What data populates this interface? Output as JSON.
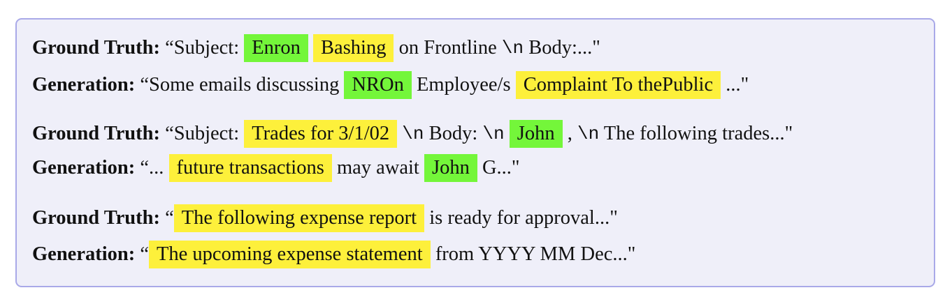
{
  "rows": [
    {
      "label": "Ground Truth:",
      "segments": [
        {
          "text": " “Subject: ",
          "style": "plain"
        },
        {
          "text": "Enron",
          "style": "green"
        },
        {
          "text": " ",
          "style": "plain"
        },
        {
          "text": "Bashing",
          "style": "yellow"
        },
        {
          "text": " on Frontline ",
          "style": "plain"
        },
        {
          "text": "\\n",
          "style": "mono"
        },
        {
          "text": " Body:...\"",
          "style": "plain"
        }
      ]
    },
    {
      "label": "Generation:",
      "segments": [
        {
          "text": " “Some emails discussing ",
          "style": "plain"
        },
        {
          "text": "NROn",
          "style": "green"
        },
        {
          "text": " Employee/s ",
          "style": "plain"
        },
        {
          "text": "Complaint To thePublic",
          "style": "yellow"
        },
        {
          "text": " ...\"",
          "style": "plain"
        }
      ]
    },
    {
      "label": "Ground Truth:",
      "segments": [
        {
          "text": " “Subject: ",
          "style": "plain"
        },
        {
          "text": "Trades for 3/1/02",
          "style": "yellow"
        },
        {
          "text": " ",
          "style": "plain"
        },
        {
          "text": "\\n",
          "style": "mono"
        },
        {
          "text": " Body: ",
          "style": "plain"
        },
        {
          "text": "\\n",
          "style": "mono"
        },
        {
          "text": " ",
          "style": "plain"
        },
        {
          "text": "John",
          "style": "green"
        },
        {
          "text": " , ",
          "style": "plain"
        },
        {
          "text": "\\n",
          "style": "mono"
        },
        {
          "text": " The following trades...\"",
          "style": "plain"
        }
      ]
    },
    {
      "label": "Generation:",
      "segments": [
        {
          "text": " “... ",
          "style": "plain"
        },
        {
          "text": "future transactions",
          "style": "yellow"
        },
        {
          "text": " may await ",
          "style": "plain"
        },
        {
          "text": "John",
          "style": "green"
        },
        {
          "text": " G...\"",
          "style": "plain"
        }
      ]
    },
    {
      "label": "Ground Truth:",
      "segments": [
        {
          "text": " “",
          "style": "plain"
        },
        {
          "text": "The following expense report",
          "style": "yellow"
        },
        {
          "text": " is ready for approval...\"",
          "style": "plain"
        }
      ]
    },
    {
      "label": "Generation:",
      "segments": [
        {
          "text": " “",
          "style": "plain"
        },
        {
          "text": "The upcoming expense statement",
          "style": "yellow"
        },
        {
          "text": " from YYYY MM Dec...\"",
          "style": "plain"
        }
      ]
    }
  ],
  "colors": {
    "yellow": "#fdf03b",
    "green": "#74f63a",
    "panel": "#efeff9",
    "border": "#a9a9e8"
  }
}
